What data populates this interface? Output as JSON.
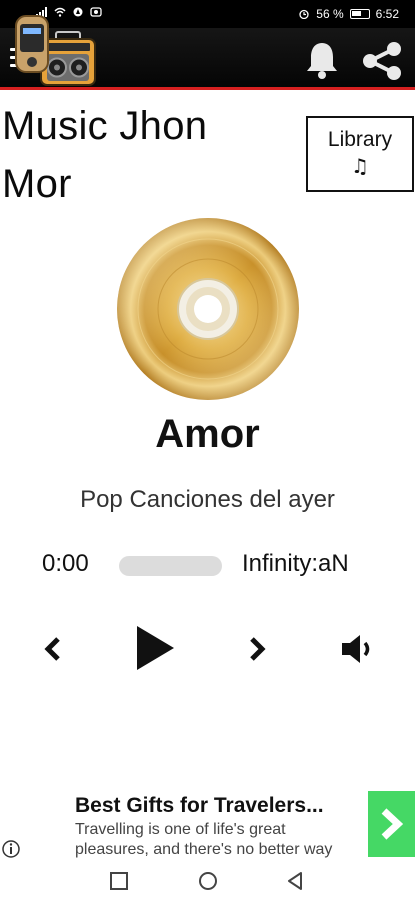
{
  "status_bar": {
    "battery": "56 %",
    "time": "6:52"
  },
  "app_bar": {
    "menu_icon": "hamburger-menu-icon",
    "app_icon": "boombox-icon",
    "bell_icon": "bell-icon",
    "share_icon": "share-icon"
  },
  "header": {
    "title": "Music Jhon Mor",
    "library_label": "Library",
    "library_icon": "♫"
  },
  "player": {
    "song_title": "Amor",
    "song_subtitle": "Pop Canciones del ayer",
    "current_time": "0:00",
    "total_time": "Infinity:aN",
    "progress": 0
  },
  "ad": {
    "title": "Best Gifts for Travelers...",
    "body": "Travelling is one of life's great pleasures, and there's no better way",
    "cta_color": "#45d865"
  },
  "colors": {
    "appbar": "#0b0b0b",
    "accent_line": "#d62020",
    "disc_gold": "#d9a93a"
  }
}
